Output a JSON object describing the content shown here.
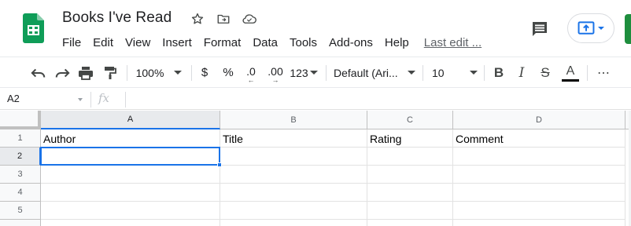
{
  "document": {
    "title": "Books I've Read",
    "last_edit": "Last edit ..."
  },
  "menu": [
    "File",
    "Edit",
    "View",
    "Insert",
    "Format",
    "Data",
    "Tools",
    "Add-ons",
    "Help"
  ],
  "toolbar": {
    "zoom": "100%",
    "currency": "$",
    "percent": "%",
    "decrease_decimal": ".0",
    "increase_decimal": ".00",
    "more_formats": "123",
    "font": "Default (Ari...",
    "font_size": "10",
    "bold": "B",
    "italic": "I",
    "strikethrough": "S",
    "text_color": "A",
    "more": "⋯"
  },
  "formula_bar": {
    "name_box": "A2",
    "fx": "fx",
    "value": ""
  },
  "sheet": {
    "columns": [
      "A",
      "B",
      "C",
      "D"
    ],
    "rows": [
      "1",
      "2",
      "3",
      "4",
      "5"
    ],
    "cells": [
      [
        "Author",
        "Title",
        "Rating",
        "Comment"
      ],
      [
        "",
        "",
        "",
        ""
      ],
      [
        "",
        "",
        "",
        ""
      ],
      [
        "",
        "",
        "",
        ""
      ],
      [
        "",
        "",
        "",
        ""
      ]
    ],
    "selected_cell": "A2"
  },
  "colors": {
    "accent": "#1a73e8",
    "sheets_green": "#0f9d58",
    "share_green": "#1e8e3e"
  }
}
